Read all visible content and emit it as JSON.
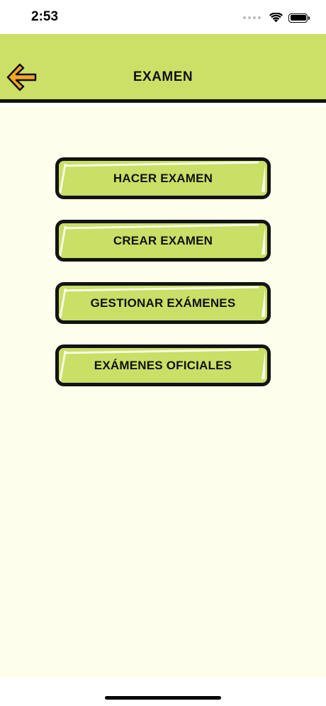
{
  "status_bar": {
    "time": "2:53"
  },
  "header": {
    "title": "EXAMEN",
    "background_color": "#cce067",
    "back_icon": "arrow-left-icon",
    "back_icon_color": "#f5a623"
  },
  "menu": {
    "items": [
      {
        "label": "HACER EXAMEN"
      },
      {
        "label": "CREAR EXAMEN"
      },
      {
        "label": "GESTIONAR EXÁMENES"
      },
      {
        "label": "EXÁMENES OFICIALES"
      }
    ],
    "button_color": "#c9df66",
    "border_color": "#131313"
  },
  "content": {
    "background_color": "#fdfeec"
  }
}
